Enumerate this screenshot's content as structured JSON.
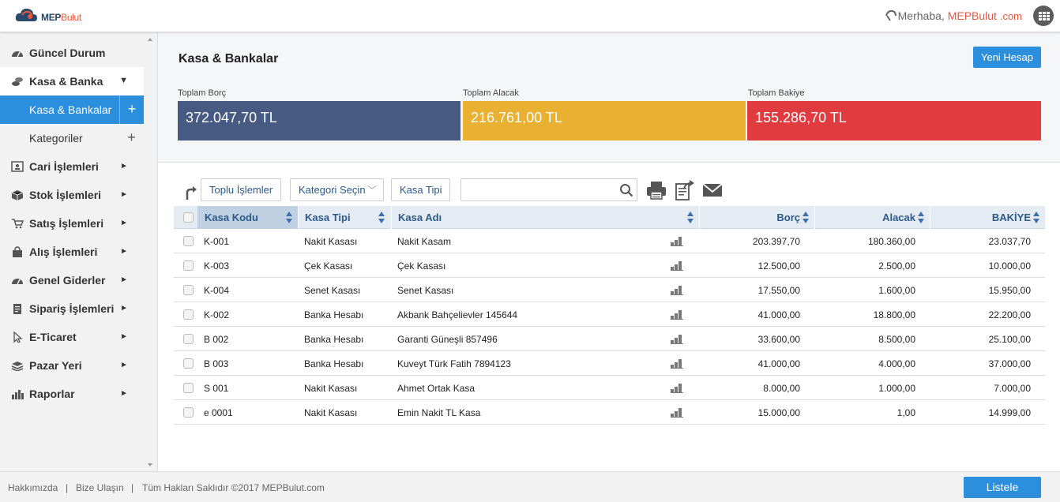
{
  "header": {
    "logo_mep": "MEP",
    "logo_bulut": "Bulut",
    "greeting": "Merhaba,",
    "user": "MEPBulut",
    "domain": ".com"
  },
  "sidebar": {
    "items": [
      {
        "label": "Güncel Durum",
        "icon": "gauge-icon"
      },
      {
        "label": "Kasa & Banka",
        "icon": "coins-icon"
      },
      {
        "label": "Cari İşlemleri",
        "icon": "contact-card-icon"
      },
      {
        "label": "Stok İşlemleri",
        "icon": "box-icon"
      },
      {
        "label": "Satış İşlemleri",
        "icon": "cart-icon"
      },
      {
        "label": "Alış İşlemleri",
        "icon": "bag-icon"
      },
      {
        "label": "Genel Giderler",
        "icon": "gauge-icon"
      },
      {
        "label": "Sipariş İşlemleri",
        "icon": "clipboard-icon"
      },
      {
        "label": "E-Ticaret",
        "icon": "cursor-icon"
      },
      {
        "label": "Pazar Yeri",
        "icon": "stack-icon"
      },
      {
        "label": "Raporlar",
        "icon": "bar-chart-icon"
      }
    ],
    "sub_items": [
      {
        "label": "Kasa & Bankalar",
        "plus": "+"
      },
      {
        "label": "Kategoriler",
        "plus": "+"
      }
    ]
  },
  "page": {
    "title": "Kasa & Bankalar",
    "new_button": "Yeni Hesap"
  },
  "stats": [
    {
      "label": "Toplam Borç",
      "value": "372.047,70 TL",
      "color": "#475a82"
    },
    {
      "label": "Toplam Alacak",
      "value": "216.761,00 TL",
      "color": "#e9b031"
    },
    {
      "label": "Toplam Bakiye",
      "value": "155.286,70 TL",
      "color": "#e03c3f"
    }
  ],
  "toolbar": {
    "bulk": "Toplu İşlemler",
    "category": "Kategori Seçin",
    "type": "Kasa Tipi",
    "search_value": ""
  },
  "table": {
    "columns": [
      "Kasa Kodu",
      "Kasa Tipi",
      "Kasa Adı",
      "Borç",
      "Alacak",
      "BAKİYE"
    ],
    "rows": [
      [
        "K-001",
        "Nakit Kasası",
        "Nakit Kasam",
        "203.397,70",
        "180.360,00",
        "23.037,70"
      ],
      [
        "K-003",
        "Çek Kasası",
        "Çek Kasası",
        "12.500,00",
        "2.500,00",
        "10.000,00"
      ],
      [
        "K-004",
        "Senet Kasası",
        "Senet Kasası",
        "17.550,00",
        "1.600,00",
        "15.950,00"
      ],
      [
        "K-002",
        "Banka Hesabı",
        "Akbank Bahçelievler 145644",
        "41.000,00",
        "18.800,00",
        "22.200,00"
      ],
      [
        "B 002",
        "Banka Hesabı",
        "Garanti Güneşli 857496",
        "33.600,00",
        "8.500,00",
        "25.100,00"
      ],
      [
        "B 003",
        "Banka Hesabı",
        "Kuveyt Türk Fatih 7894123",
        "41.000,00",
        "4.000,00",
        "37.000,00"
      ],
      [
        "S 001",
        "Nakit Kasası",
        "Ahmet Ortak Kasa",
        "8.000,00",
        "1.000,00",
        "7.000,00"
      ],
      [
        "e 0001",
        "Nakit Kasası",
        "Emin Nakit TL Kasa",
        "15.000,00",
        "1,00",
        "14.999,00"
      ]
    ]
  },
  "footer": {
    "about": "Hakkımızda",
    "sep": "|",
    "contact": "Bize Ulaşın",
    "copyright": "Tüm Hakları Saklıdır ©2017 MEPBulut.com",
    "list_button": "Listele"
  },
  "colors": {
    "accent": "#2c8fdd",
    "brand_orange": "#e8563f",
    "header_text": "#2d5a88"
  }
}
